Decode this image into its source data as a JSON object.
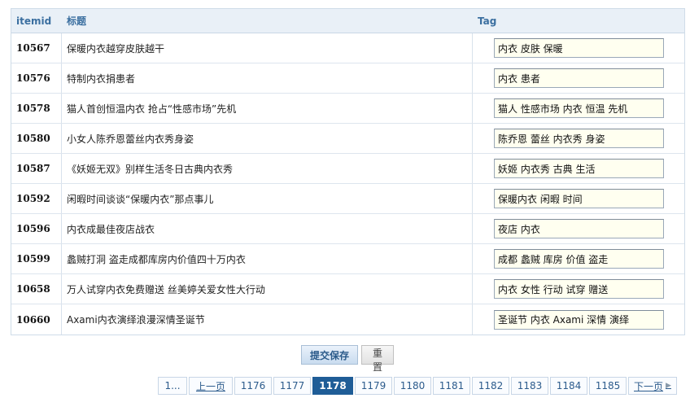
{
  "header": {
    "col_id": "itemid",
    "col_title": "标题",
    "col_tag": "Tag"
  },
  "rows": [
    {
      "id": "10567",
      "title": "保暖内衣越穿皮肤越干",
      "tag": "内衣 皮肤 保暖"
    },
    {
      "id": "10576",
      "title": "特制内衣捐患者",
      "tag": "内衣 患者"
    },
    {
      "id": "10578",
      "title": "猫人首创恒温内衣 抢占“性感市场”先机",
      "tag": "猫人 性感市场 内衣 恒温 先机"
    },
    {
      "id": "10580",
      "title": "小女人陈乔恩蕾丝内衣秀身姿",
      "tag": "陈乔恩 蕾丝 内衣秀 身姿"
    },
    {
      "id": "10587",
      "title": "《妖姬无双》别样生活冬日古典内衣秀",
      "tag": "妖姬 内衣秀 古典 生活"
    },
    {
      "id": "10592",
      "title": "闲暇时间谈谈“保暖内衣”那点事儿",
      "tag": "保暖内衣 闲暇 时间"
    },
    {
      "id": "10596",
      "title": "内衣成最佳夜店战衣",
      "tag": "夜店 内衣"
    },
    {
      "id": "10599",
      "title": "蠡贼打洞 盗走成都库房内价值四十万内衣",
      "tag": "成都 蠡贼 库房 价值 盗走"
    },
    {
      "id": "10658",
      "title": "万人试穿内衣免费赠送 丝美婷关爱女性大行动",
      "tag": "内衣 女性 行动 试穿 赠送"
    },
    {
      "id": "10660",
      "title": "Axami内衣演绎浪漫深情圣诞节",
      "tag": "圣诞节 内衣 Axami 深情 演绎"
    }
  ],
  "buttons": {
    "submit": "提交保存",
    "reset": "重置"
  },
  "pagination": {
    "first": "1...",
    "prev": "上一页",
    "pages": [
      "1176",
      "1177",
      "1178",
      "1179",
      "1180",
      "1181",
      "1182",
      "1183",
      "1184",
      "1185"
    ],
    "current": "1178",
    "next": "下一页"
  }
}
